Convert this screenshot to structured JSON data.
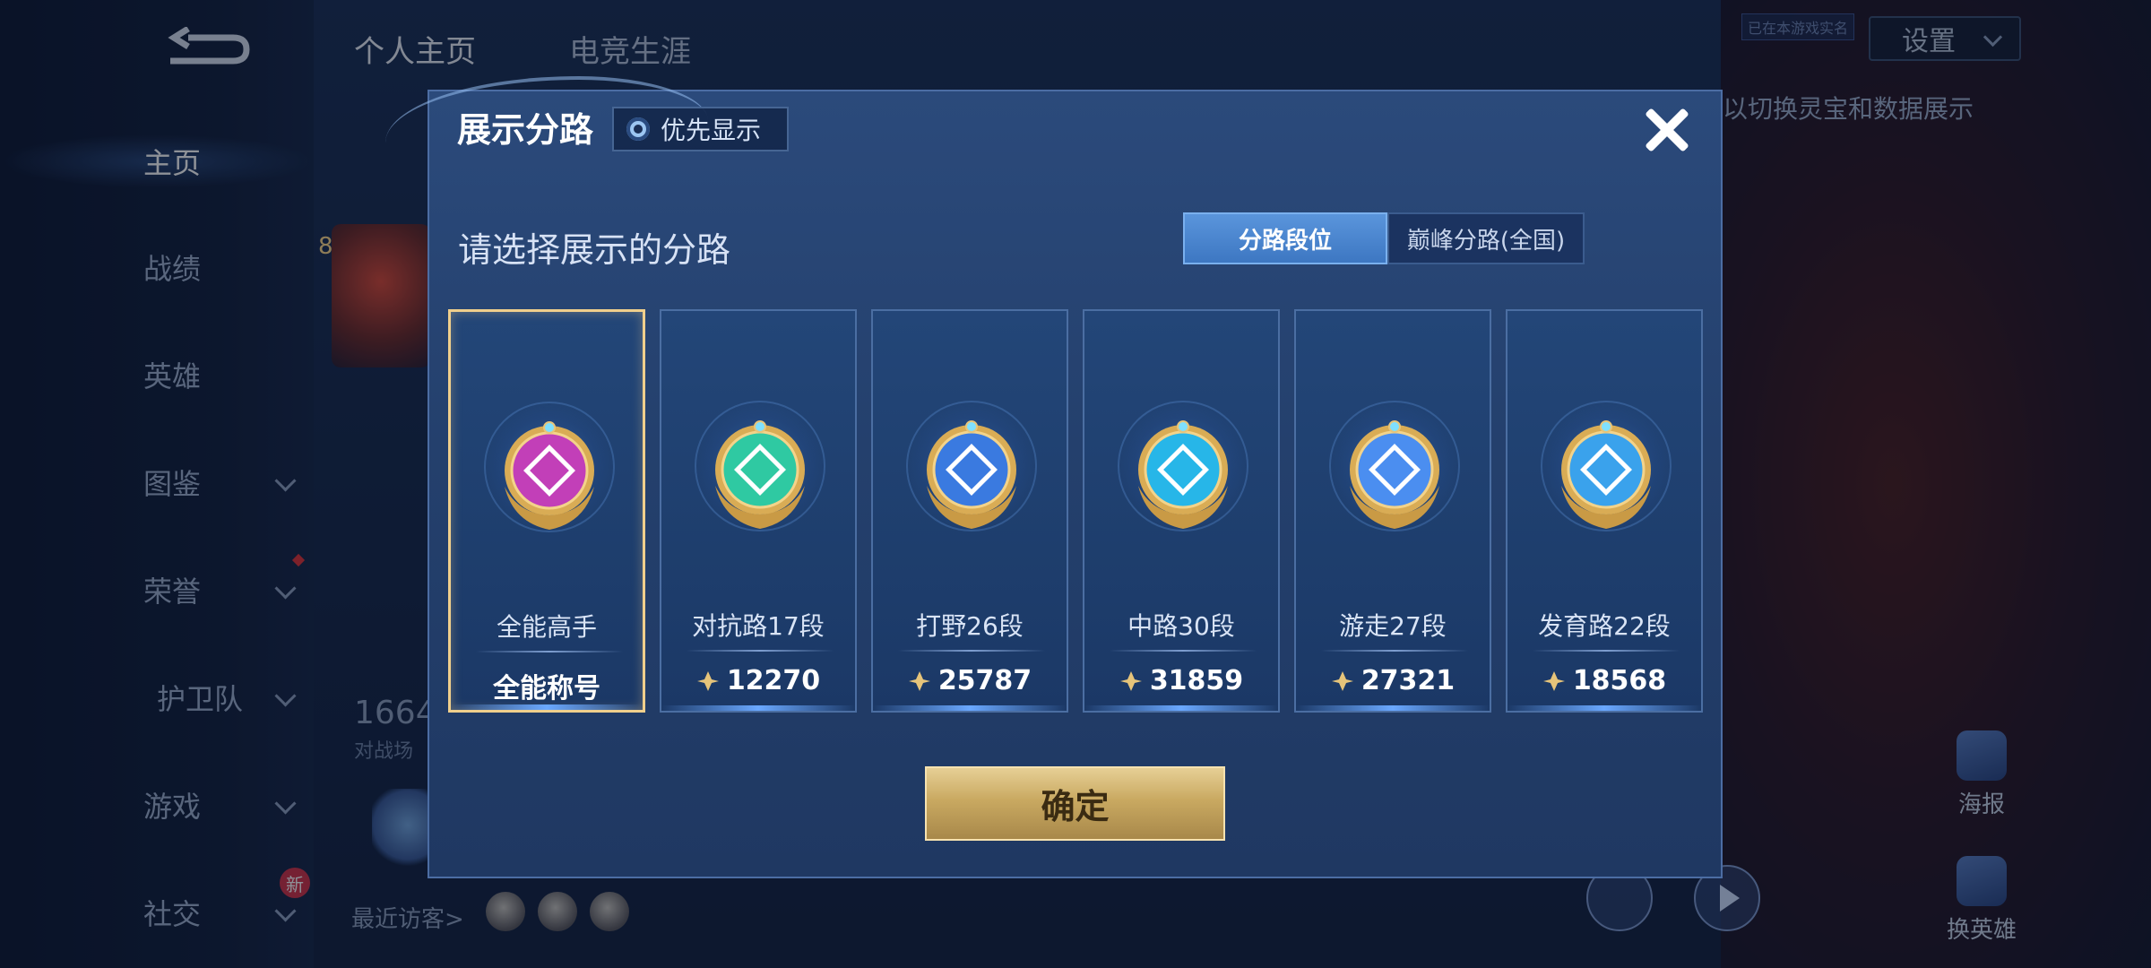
{
  "sidebar": {
    "items": [
      {
        "label": "主页"
      },
      {
        "label": "战绩"
      },
      {
        "label": "英雄"
      },
      {
        "label": "图鉴"
      },
      {
        "label": "荣誉"
      },
      {
        "label": "护卫队"
      },
      {
        "label": "游戏"
      },
      {
        "label": "社交"
      }
    ],
    "new_tag": "新"
  },
  "background": {
    "tabs": [
      "个人主页",
      "电竞生涯"
    ],
    "settings_label": "设置",
    "realname_label": "已在本游戏实名",
    "hint_text": "以切换灵宝和数据展示",
    "level": "8",
    "stat_number": "1664",
    "stat_label": "对战场",
    "visitors_label": "最近访客>",
    "poster_label": "海报",
    "change_hero_label": "换英雄"
  },
  "modal": {
    "title": "展示分路",
    "priority_label": "优先显示",
    "subtitle": "请选择展示的分路",
    "segments": [
      "分路段位",
      "巅峰分路(全国)"
    ],
    "active_segment": "分路段位",
    "cards": [
      {
        "title": "全能高手",
        "value": "全能称号",
        "selected": true,
        "icon": "allrounder-emblem-icon",
        "color": "#c23fb8"
      },
      {
        "title": "对抗路17段",
        "value": "12270",
        "selected": false,
        "icon": "clash-lane-emblem-icon",
        "color": "#2fc9a2"
      },
      {
        "title": "打野26段",
        "value": "25787",
        "selected": false,
        "icon": "jungle-emblem-icon",
        "color": "#3a7ae0"
      },
      {
        "title": "中路30段",
        "value": "31859",
        "selected": false,
        "icon": "mid-lane-emblem-icon",
        "color": "#27b6e8"
      },
      {
        "title": "游走27段",
        "value": "27321",
        "selected": false,
        "icon": "roam-emblem-icon",
        "color": "#4b8ef0"
      },
      {
        "title": "发育路22段",
        "value": "18568",
        "selected": false,
        "icon": "farm-lane-emblem-icon",
        "color": "#3aa2ec"
      }
    ],
    "confirm_label": "确定",
    "accent_gold": "#e6cf95"
  }
}
